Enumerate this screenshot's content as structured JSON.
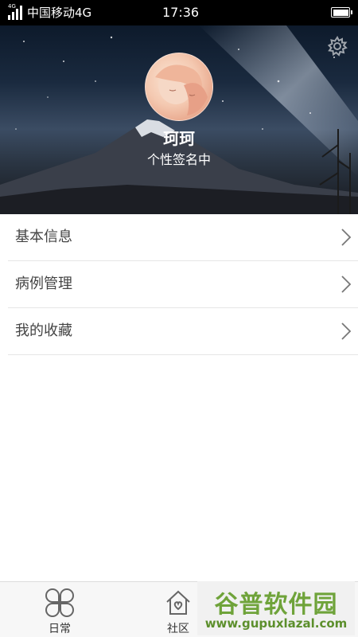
{
  "status_bar": {
    "network_tag": "4G",
    "carrier": "中国移动4G",
    "time": "17:36",
    "battery_level": 1.0
  },
  "profile": {
    "nickname": "珂珂",
    "signature": "个性签名中",
    "avatar_icon": "avatar-image",
    "settings_icon": "gear-icon"
  },
  "menu": {
    "items": [
      {
        "label": "基本信息",
        "icon": "chevron-right-icon"
      },
      {
        "label": "病例管理",
        "icon": "chevron-right-icon"
      },
      {
        "label": "我的收藏",
        "icon": "chevron-right-icon"
      }
    ]
  },
  "tabbar": {
    "tabs": [
      {
        "label": "日常",
        "icon": "clover-icon"
      },
      {
        "label": "社区",
        "icon": "home-icon"
      }
    ]
  },
  "watermark": {
    "title": "谷普软件园",
    "url": "www.gupuxlazal.com"
  },
  "colors": {
    "status_bar_bg": "#000000",
    "divider": "#e6e6e6",
    "watermark_green": "#6fa33a"
  }
}
